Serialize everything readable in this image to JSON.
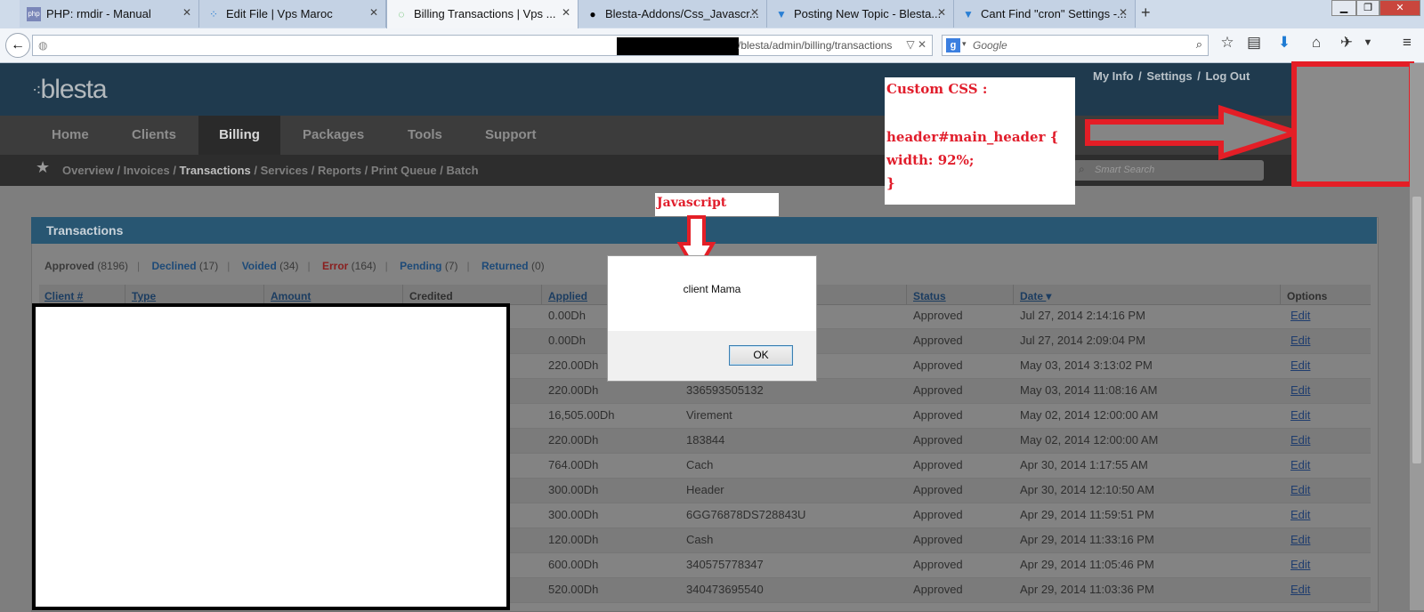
{
  "browser": {
    "tabs": [
      {
        "label": "PHP: rmdir - Manual",
        "icon": "php-icon"
      },
      {
        "label": "Edit File | Vps Maroc",
        "icon": "blesta-icon"
      },
      {
        "label": "Billing Transactions | Vps ...",
        "icon": "loading-icon",
        "active": true
      },
      {
        "label": "Blesta-Addons/Css_Javascr...",
        "icon": "github-icon"
      },
      {
        "label": "Posting New Topic - Blesta...",
        "icon": "blesta-forum-icon"
      },
      {
        "label": "Cant Find \"cron\" Settings -...",
        "icon": "blesta-forum-icon"
      }
    ],
    "new_tab": "+",
    "url_visible": "/blesta/admin/billing/transactions",
    "search_placeholder": "Google"
  },
  "app": {
    "logo": "blesta",
    "toplinks": [
      "My Info",
      "Settings",
      "Log Out"
    ],
    "nav": [
      "Home",
      "Clients",
      "Billing",
      "Packages",
      "Tools",
      "Support"
    ],
    "nav_active": "Billing",
    "subnav": [
      "Overview",
      "Invoices",
      "Transactions",
      "Services",
      "Reports",
      "Print Queue",
      "Batch"
    ],
    "subnav_active": "Transactions",
    "smart_search_placeholder": "Smart Search"
  },
  "panel": {
    "title": "Transactions",
    "filters": [
      {
        "label": "Approved",
        "count": "(8196)",
        "color": "#3a3a3a"
      },
      {
        "label": "Declined",
        "count": "(17)",
        "color": "#1d4a78"
      },
      {
        "label": "Voided",
        "count": "(34)",
        "color": "#1d4a78"
      },
      {
        "label": "Error",
        "count": "(164)",
        "color": "#8a1f1f"
      },
      {
        "label": "Pending",
        "count": "(7)",
        "color": "#1d4a78"
      },
      {
        "label": "Returned",
        "count": "(0)",
        "color": "#1d4a78"
      }
    ],
    "columns": [
      "Client #",
      "Type",
      "Amount",
      "Credited",
      "Applied",
      "Status",
      "Date",
      "Options"
    ],
    "rows": [
      {
        "applied": "0.00Dh",
        "ref": "",
        "status": "Approved",
        "date": "Jul 27, 2014 2:14:16 PM",
        "option": "Edit"
      },
      {
        "applied": "0.00Dh",
        "ref": "",
        "status": "Approved",
        "date": "Jul 27, 2014 2:09:04 PM",
        "option": "Edit"
      },
      {
        "applied": "220.00Dh",
        "ref": "",
        "status": "Approved",
        "date": "May 03, 2014 3:13:02 PM",
        "option": "Edit"
      },
      {
        "applied": "220.00Dh",
        "ref": "336593505132",
        "status": "Approved",
        "date": "May 03, 2014 11:08:16 AM",
        "option": "Edit"
      },
      {
        "applied": "16,505.00Dh",
        "ref": "Virement",
        "status": "Approved",
        "date": "May 02, 2014 12:00:00 AM",
        "option": "Edit"
      },
      {
        "applied": "220.00Dh",
        "ref": "183844",
        "status": "Approved",
        "date": "May 02, 2014 12:00:00 AM",
        "option": "Edit"
      },
      {
        "applied": "764.00Dh",
        "ref": "Cach",
        "status": "Approved",
        "date": "Apr 30, 2014 1:17:55 AM",
        "option": "Edit"
      },
      {
        "applied": "300.00Dh",
        "ref": "Header",
        "status": "Approved",
        "date": "Apr 30, 2014 12:10:50 AM",
        "option": "Edit"
      },
      {
        "applied": "300.00Dh",
        "ref": "6GG76878DS728843U",
        "status": "Approved",
        "date": "Apr 29, 2014 11:59:51 PM",
        "option": "Edit"
      },
      {
        "applied": "120.00Dh",
        "ref": "Cash",
        "status": "Approved",
        "date": "Apr 29, 2014 11:33:16 PM",
        "option": "Edit"
      },
      {
        "applied": "600.00Dh",
        "ref": "340575778347",
        "status": "Approved",
        "date": "Apr 29, 2014 11:05:46 PM",
        "option": "Edit"
      },
      {
        "applied": "520.00Dh",
        "ref": "340473695540",
        "status": "Approved",
        "date": "Apr 29, 2014 11:03:36 PM",
        "option": "Edit"
      }
    ]
  },
  "dialog": {
    "message": "client Mama",
    "ok_label": "OK"
  },
  "annotations": {
    "css_lines": [
      "Custom CSS :",
      "",
      "header#main_header {",
      "     width: 92%;",
      "}"
    ],
    "js_label": "Javascript"
  }
}
